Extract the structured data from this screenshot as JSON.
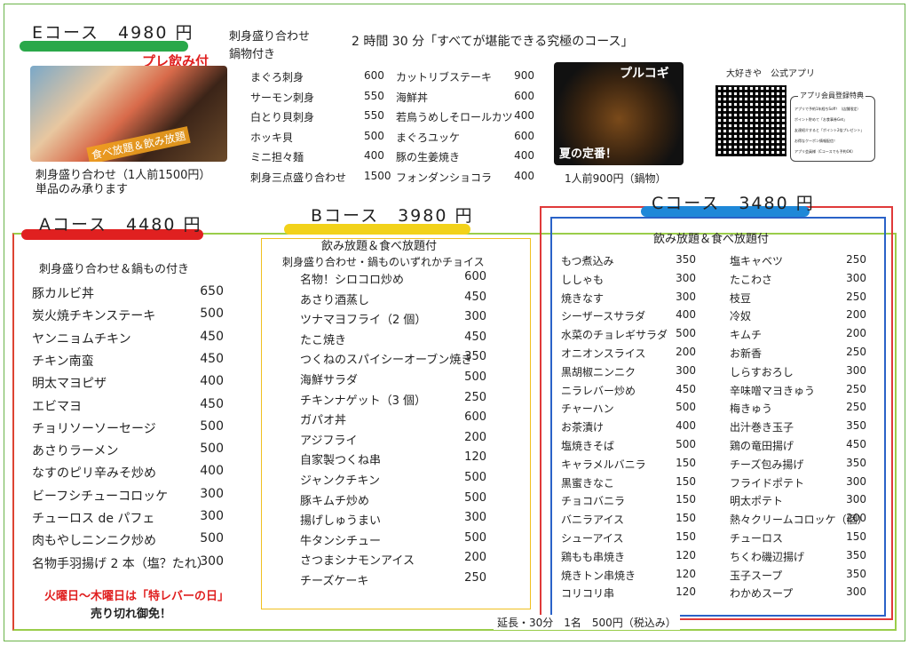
{
  "e_course": {
    "title": "Eコース　4980 円",
    "badge": "プレ飲み付",
    "desc1": "刺身盛り合わせ",
    "desc2": "鍋物付き",
    "headline": "2 時間 30 分「すべてが堪能できる究極のコース」",
    "photo_label": "食べ放題＆飲み放題",
    "note1": "刺身盛り合わせ（1人前1500円）",
    "note2": "単品のみ承ります",
    "items_left": [
      {
        "name": "まぐろ刺身",
        "price": "600"
      },
      {
        "name": "サーモン刺身",
        "price": "550"
      },
      {
        "name": "白とり貝刺身",
        "price": "550"
      },
      {
        "name": "ホッキ貝",
        "price": "500"
      },
      {
        "name": "ミニ担々麺",
        "price": "400"
      },
      {
        "name": "刺身三点盛り合わせ",
        "price": "1500"
      }
    ],
    "items_right": [
      {
        "name": "カットリブステーキ",
        "price": "900"
      },
      {
        "name": "海鮮丼",
        "price": "600"
      },
      {
        "name": "若鳥うめしそロールカツ",
        "price": "400"
      },
      {
        "name": "まぐろユッケ",
        "price": "600"
      },
      {
        "name": "豚の生姜焼き",
        "price": "400"
      },
      {
        "name": "フォンダンショコラ",
        "price": "400"
      }
    ]
  },
  "bulgogi": {
    "label": "プルコギ",
    "sub": "夏の定番！",
    "price": "1人前900円（鍋物）"
  },
  "app": {
    "title": "大好きや　公式アプリ",
    "box_title": "アプリ会員登録特典",
    "lines": [
      "アプリで予約1年経ちSoff！（店舗限定）",
      "ポイント貯めて「お食事券Get」",
      "友達紹介すると「ポイント2倍プレゼント」",
      "お得なクーポン情報配信！",
      "アプリ会員様（Cコースでも予約OK）"
    ]
  },
  "a_course": {
    "title": "Aコース　4480 円",
    "sub": "刺身盛り合わせ＆鍋もの付き",
    "items": [
      {
        "name": "豚カルビ丼",
        "price": "650"
      },
      {
        "name": "炭火焼チキンステーキ",
        "price": "500"
      },
      {
        "name": "ヤンニョムチキン",
        "price": "450"
      },
      {
        "name": "チキン南蛮",
        "price": "450"
      },
      {
        "name": "明太マヨピザ",
        "price": "400"
      },
      {
        "name": "エビマヨ",
        "price": "450"
      },
      {
        "name": "チョリソーソーセージ",
        "price": "500"
      },
      {
        "name": "あさりラーメン",
        "price": "500"
      },
      {
        "name": "なすのピリ辛みそ炒め",
        "price": "400"
      },
      {
        "name": "ビーフシチューコロッケ",
        "price": "300"
      },
      {
        "name": "チューロス de パフェ",
        "price": "300"
      },
      {
        "name": "肉もやしニンニク炒め",
        "price": "500"
      },
      {
        "name": "名物手羽揚げ 2 本（塩？たれ）",
        "price": "300"
      }
    ],
    "notice1": "火曜日～木曜日は「特レバーの日」",
    "notice2": "売り切れ御免！"
  },
  "b_course": {
    "title": "Bコース　3980 円",
    "sub1": "飲み放題＆食べ放題付",
    "sub2": "刺身盛り合わせ・鍋ものいずれかチョイス",
    "items": [
      {
        "name": "名物！シロコロ炒め",
        "price": "600"
      },
      {
        "name": "あさり酒蒸し",
        "price": "450"
      },
      {
        "name": "ツナマヨフライ（2 個）",
        "price": "300"
      },
      {
        "name": "たこ焼き",
        "price": "450"
      },
      {
        "name": "つくねのスパイシーオーブン焼き",
        "price": "350"
      },
      {
        "name": "海鮮サラダ",
        "price": "500"
      },
      {
        "name": "チキンナゲット（3 個）",
        "price": "250"
      },
      {
        "name": "ガパオ丼",
        "price": "600"
      },
      {
        "name": "アジフライ",
        "price": "200"
      },
      {
        "name": "自家製つくね串",
        "price": "120"
      },
      {
        "name": "ジャンクチキン",
        "price": "500"
      },
      {
        "name": "豚キムチ炒め",
        "price": "500"
      },
      {
        "name": "揚げしゅうまい",
        "price": "300"
      },
      {
        "name": "牛タンシチュー",
        "price": "500"
      },
      {
        "name": "さつまシナモンアイス",
        "price": "200"
      },
      {
        "name": "チーズケーキ",
        "price": "250"
      }
    ]
  },
  "c_course": {
    "title": "Cコース　3480 円",
    "sub": "飲み放題＆食べ放題付",
    "items_left": [
      {
        "name": "もつ煮込み",
        "price": "350"
      },
      {
        "name": "ししゃも",
        "price": "300"
      },
      {
        "name": "焼きなす",
        "price": "300"
      },
      {
        "name": "シーザースサラダ",
        "price": "400"
      },
      {
        "name": "水菜のチョレギサラダ",
        "price": "500"
      },
      {
        "name": "オニオンスライス",
        "price": "200"
      },
      {
        "name": "黒胡椒ニンニク",
        "price": "300"
      },
      {
        "name": "ニラレバー炒め",
        "price": "450"
      },
      {
        "name": "チャーハン",
        "price": "500"
      },
      {
        "name": "お茶漬け",
        "price": "400"
      },
      {
        "name": "塩焼きそば",
        "price": "500"
      },
      {
        "name": "キャラメルバニラ",
        "price": "150"
      },
      {
        "name": "黒蜜きなこ",
        "price": "150"
      },
      {
        "name": "チョコバニラ",
        "price": "150"
      },
      {
        "name": "バニラアイス",
        "price": "150"
      },
      {
        "name": "シューアイス",
        "price": "150"
      },
      {
        "name": "鶏もも串焼き",
        "price": "120"
      },
      {
        "name": "焼きトン串焼き",
        "price": "120"
      },
      {
        "name": "コリコリ串",
        "price": "120"
      }
    ],
    "items_right": [
      {
        "name": "塩キャベツ",
        "price": "250"
      },
      {
        "name": "たこわさ",
        "price": "300"
      },
      {
        "name": "枝豆",
        "price": "250"
      },
      {
        "name": "冷奴",
        "price": "200"
      },
      {
        "name": "キムチ",
        "price": "200"
      },
      {
        "name": "お新香",
        "price": "250"
      },
      {
        "name": "しらすおろし",
        "price": "300"
      },
      {
        "name": "辛味噌マヨきゅう",
        "price": "250"
      },
      {
        "name": "梅きゅう",
        "price": "250"
      },
      {
        "name": "出汁巻き玉子",
        "price": "350"
      },
      {
        "name": "鶏の竜田揚げ",
        "price": "450"
      },
      {
        "name": "チーズ包み揚げ",
        "price": "350"
      },
      {
        "name": "フライドポテト",
        "price": "300"
      },
      {
        "name": "明太ポテト",
        "price": "300"
      },
      {
        "name": "熱々クリームコロッケ（個）",
        "price": "200"
      },
      {
        "name": "チューロス",
        "price": "150"
      },
      {
        "name": "ちくわ磯辺揚げ",
        "price": "350"
      },
      {
        "name": "玉子スープ",
        "price": "350"
      },
      {
        "name": "わかめスープ",
        "price": "300"
      }
    ]
  },
  "footer": "延長・30分　1名　500円（税込み）",
  "colors": {
    "red": "#e02020",
    "green": "#2aa84a",
    "yellow": "#f2d21a",
    "blue": "#1e88d8"
  }
}
